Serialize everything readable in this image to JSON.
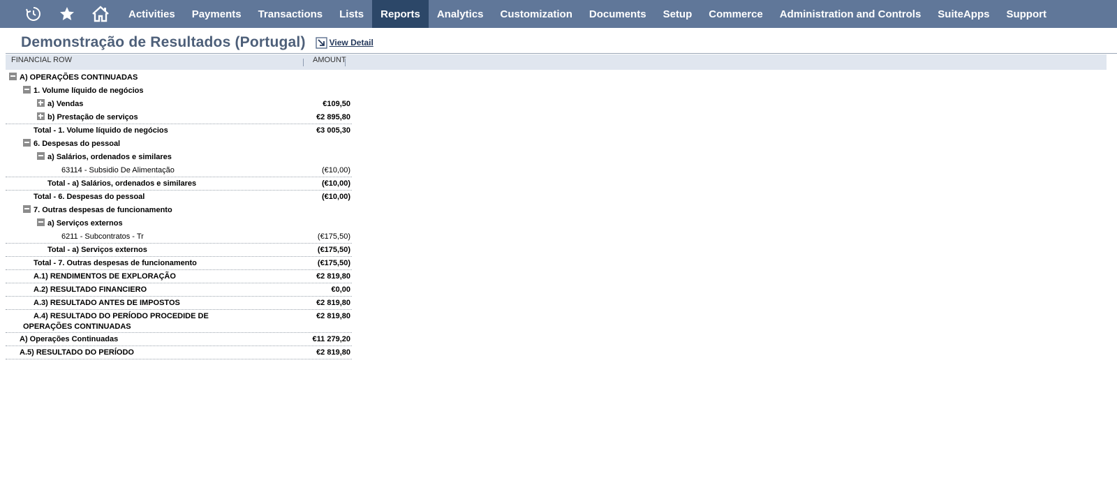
{
  "nav": {
    "icons": [
      "recent-records-icon",
      "favorites-star-icon",
      "home-icon"
    ],
    "items": [
      {
        "label": "Activities"
      },
      {
        "label": "Payments"
      },
      {
        "label": "Transactions"
      },
      {
        "label": "Lists"
      },
      {
        "label": "Reports"
      },
      {
        "label": "Analytics"
      },
      {
        "label": "Customization"
      },
      {
        "label": "Documents"
      },
      {
        "label": "Setup"
      },
      {
        "label": "Commerce"
      },
      {
        "label": "Administration and Controls"
      },
      {
        "label": "SuiteApps"
      },
      {
        "label": "Support"
      }
    ],
    "active_item": "Reports"
  },
  "colors": {
    "nav_bg": "#607799",
    "nav_active_bg": "#2c4768",
    "title": "#4d5f79",
    "header_bg": "#e0e6ef"
  },
  "page": {
    "title": "Demonstração de Resultados (Portugal)",
    "view_detail_label": "View Detail"
  },
  "report": {
    "columns": {
      "label": "FINANCIAL ROW",
      "amount": "AMOUNT"
    },
    "rows": [
      {
        "label": "A) OPERAÇÕES CONTINUADAS",
        "amount": "",
        "toggle": "minus",
        "bold": true,
        "line": false
      },
      {
        "label": "1. Volume líquido de negócios",
        "amount": "",
        "toggle": "minus",
        "bold": true,
        "line": false
      },
      {
        "label": "a) Vendas",
        "amount": "€109,50",
        "toggle": "plus",
        "bold": true,
        "line": false
      },
      {
        "label": "b) Prestação de serviços",
        "amount": "€2 895,80",
        "toggle": "plus",
        "bold": true,
        "line": true
      },
      {
        "label": "Total - 1. Volume líquido de negócios",
        "amount": "€3 005,30",
        "toggle": "",
        "bold": true,
        "line": false
      },
      {
        "label": "6. Despesas do pessoal",
        "amount": "",
        "toggle": "minus",
        "bold": true,
        "line": false
      },
      {
        "label": "a) Salários, ordenados e similares",
        "amount": "",
        "toggle": "minus",
        "bold": true,
        "line": false
      },
      {
        "label": "63114 - Subsidio De Alimentação",
        "amount": "(€10,00)",
        "toggle": "",
        "bold": false,
        "line": true
      },
      {
        "label": "Total - a) Salários, ordenados e similares",
        "amount": "(€10,00)",
        "toggle": "",
        "bold": true,
        "line": true
      },
      {
        "label": "Total - 6. Despesas do pessoal",
        "amount": "(€10,00)",
        "toggle": "",
        "bold": true,
        "line": false
      },
      {
        "label": "7. Outras despesas de funcionamento",
        "amount": "",
        "toggle": "minus",
        "bold": true,
        "line": false
      },
      {
        "label": "a) Serviços externos",
        "amount": "",
        "toggle": "minus",
        "bold": true,
        "line": false
      },
      {
        "label": "6211 - Subcontratos - Tr",
        "amount": "(€175,50)",
        "toggle": "",
        "bold": false,
        "line": true
      },
      {
        "label": "Total - a) Serviços externos",
        "amount": "(€175,50)",
        "toggle": "",
        "bold": true,
        "line": true
      },
      {
        "label": "Total - 7. Outras despesas de funcionamento",
        "amount": "(€175,50)",
        "toggle": "",
        "bold": true,
        "line": true
      },
      {
        "label": "A.1) RENDIMENTOS DE EXPLORAÇÃO",
        "amount": "€2 819,80",
        "toggle": "",
        "bold": true,
        "line": true
      },
      {
        "label": "A.2) RESULTADO FINANCIERO",
        "amount": "€0,00",
        "toggle": "",
        "bold": true,
        "line": true
      },
      {
        "label": "A.3) RESULTADO ANTES DE IMPOSTOS",
        "amount": "€2 819,80",
        "toggle": "",
        "bold": true,
        "line": true
      },
      {
        "label": "A.4) RESULTADO DO PERÍODO PROCEDIDE DE OPERAÇÕES CONTINUADAS",
        "amount": "€2 819,80",
        "toggle": "",
        "bold": true,
        "line": true
      },
      {
        "label": "A) Operações Continuadas",
        "amount": "€11 279,20",
        "toggle": "",
        "bold": true,
        "line": true
      },
      {
        "label": "A.5) RESULTADO DO PERÍODO",
        "amount": "€2 819,80",
        "toggle": "",
        "bold": true,
        "line": true
      }
    ]
  }
}
